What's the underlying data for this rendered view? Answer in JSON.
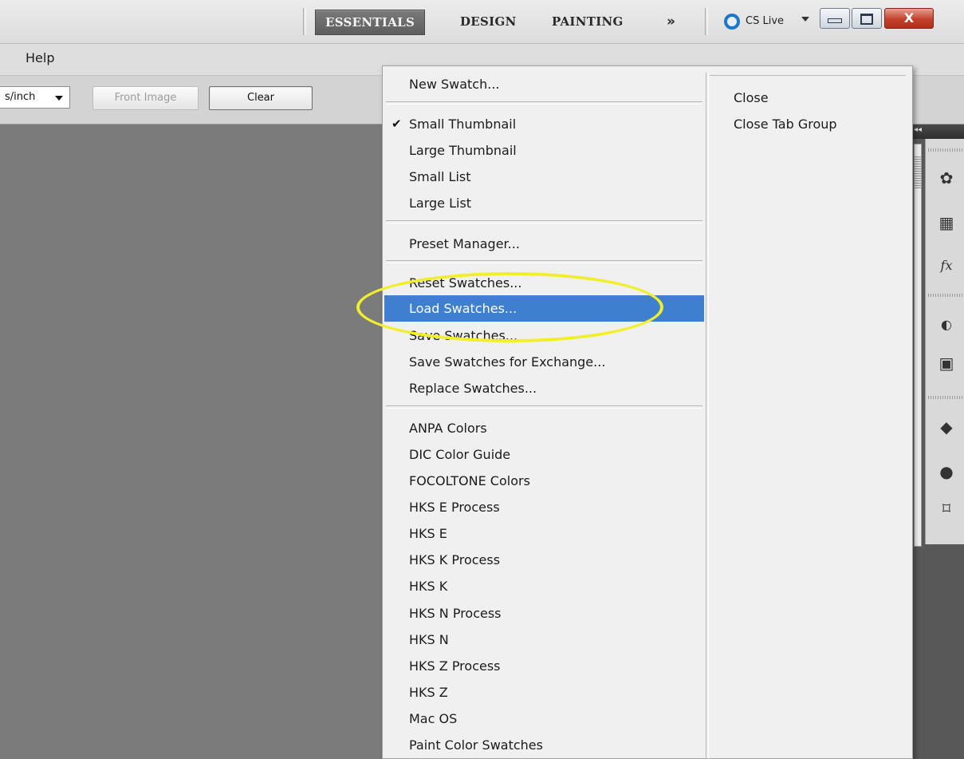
{
  "workspace": {
    "essentials": "ESSENTIALS",
    "design": "DESIGN",
    "painting": "PAINTING",
    "more": "»",
    "cs_live": "CS Live",
    "close_glyph": "X"
  },
  "menubar": {
    "help": "Help"
  },
  "options": {
    "resolution_unit": "s/inch",
    "front_image": "Front Image",
    "clear": "Clear"
  },
  "panel": {
    "collapse_arrows": "◂◂"
  },
  "flyout": {
    "items": [
      {
        "label": "New Swatch..."
      },
      {
        "label": "Small Thumbnail",
        "checked": true
      },
      {
        "label": "Large Thumbnail"
      },
      {
        "label": "Small List"
      },
      {
        "label": "Large List"
      },
      {
        "label": "Preset Manager..."
      },
      {
        "label": "Reset Swatches..."
      },
      {
        "label": "Load Swatches...",
        "highlighted": true
      },
      {
        "label": "Save Swatches..."
      },
      {
        "label": "Save Swatches for Exchange..."
      },
      {
        "label": "Replace Swatches..."
      },
      {
        "label": "ANPA Colors"
      },
      {
        "label": "DIC Color Guide"
      },
      {
        "label": "FOCOLTONE Colors"
      },
      {
        "label": "HKS E Process"
      },
      {
        "label": "HKS E"
      },
      {
        "label": "HKS K Process"
      },
      {
        "label": "HKS K"
      },
      {
        "label": "HKS N Process"
      },
      {
        "label": "HKS N"
      },
      {
        "label": "HKS Z Process"
      },
      {
        "label": "HKS Z"
      },
      {
        "label": "Mac OS"
      },
      {
        "label": "Paint Color Swatches"
      }
    ],
    "right_items": [
      {
        "label": "Close"
      },
      {
        "label": "Close Tab Group"
      }
    ]
  },
  "colors": {
    "highlight": "#3f7fcf",
    "annotation": "#f1ef2c",
    "canvas": "#7b7b7b"
  }
}
